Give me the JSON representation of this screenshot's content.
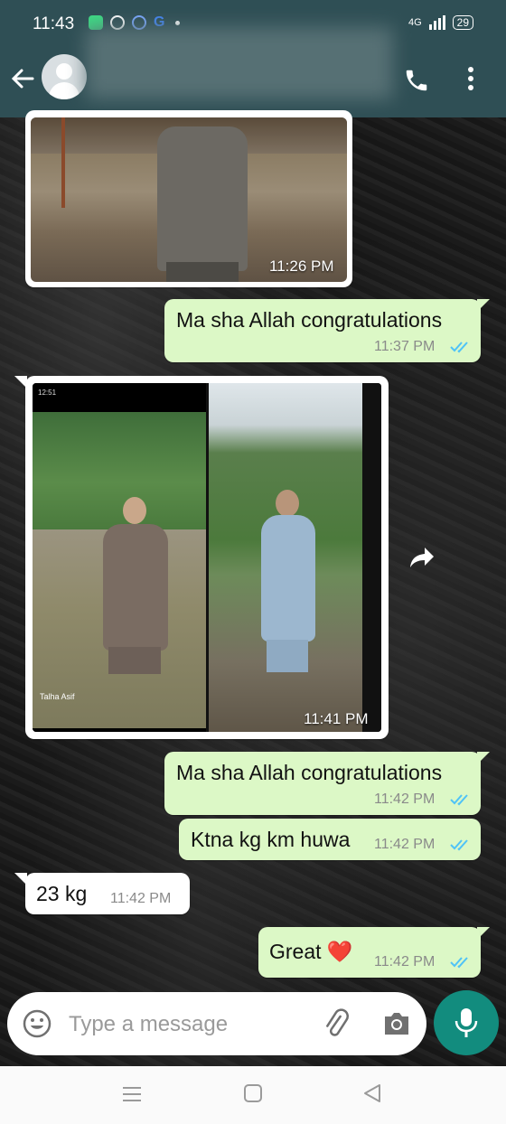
{
  "status_bar": {
    "time": "11:43",
    "network": "4G",
    "battery": "29"
  },
  "header": {
    "contact_name": ""
  },
  "messages": [
    {
      "direction": "in",
      "type": "image",
      "time": "11:26 PM"
    },
    {
      "direction": "out",
      "type": "text",
      "text": "Ma sha Allah congratulations",
      "time": "11:37 PM",
      "status": "read"
    },
    {
      "direction": "in",
      "type": "image",
      "time": "11:41 PM",
      "caption_overlay": "Talha Asif",
      "phone_time": "12:51"
    },
    {
      "direction": "out",
      "type": "text",
      "text": "Ma sha Allah congratulations",
      "time": "11:42 PM",
      "status": "read"
    },
    {
      "direction": "out",
      "type": "text",
      "text": "Ktna kg km huwa",
      "time": "11:42 PM",
      "status": "read"
    },
    {
      "direction": "in",
      "type": "text",
      "text": "23 kg",
      "time": "11:42 PM"
    },
    {
      "direction": "out",
      "type": "text",
      "text": "Great ❤️",
      "time": "11:42 PM",
      "status": "read"
    }
  ],
  "composer": {
    "placeholder": "Type a message"
  },
  "colors": {
    "header": "#2f4f55",
    "outgoing": "#dcf8c6",
    "incoming": "#ffffff",
    "read_ticks": "#4fc3f7",
    "mic": "#128c7e"
  },
  "icons": [
    "back-arrow-icon",
    "avatar-icon",
    "call-icon",
    "more-options-icon",
    "forward-icon",
    "emoji-icon",
    "attach-icon",
    "camera-icon",
    "mic-icon",
    "recent-apps-icon",
    "home-icon",
    "back-nav-icon"
  ]
}
